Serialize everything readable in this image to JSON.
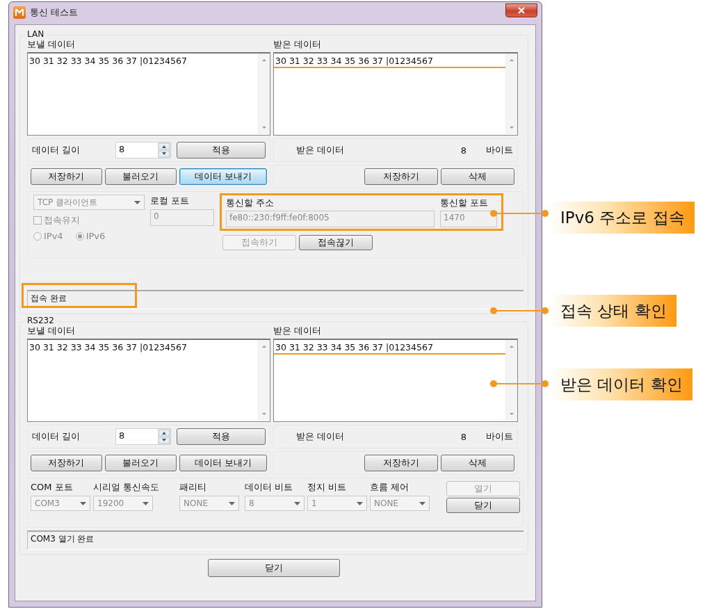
{
  "window": {
    "title": "통신 테스트"
  },
  "lan": {
    "title": "LAN",
    "send": {
      "label": "보낼 데이터",
      "value": "30 31 32 33 34 35 36 37 |01234567"
    },
    "receive": {
      "label": "받은 데이터",
      "value": "30 31 32 33 34 35 36 37 |01234567"
    },
    "length": {
      "label": "데이터 길이",
      "value": "8",
      "apply": "적용"
    },
    "received_count": {
      "label": "받은 데이터",
      "value": "8",
      "unit": "바이트"
    },
    "send_buttons": [
      {
        "label": "저장하기",
        "focused": false
      },
      {
        "label": "불러오기",
        "focused": false
      },
      {
        "label": "데이터 보내기",
        "focused": true
      }
    ],
    "receive_buttons": [
      "저장하기",
      "삭제"
    ],
    "connection": {
      "mode": "TCP 클라이언트",
      "keep_alive": {
        "label": "접속유지",
        "checked": false
      },
      "ip_versions": [
        {
          "label": "IPv4",
          "selected": false
        },
        {
          "label": "IPv6",
          "selected": true
        }
      ],
      "local_port": {
        "label": "로컬 포트",
        "value": "0",
        "disabled": true
      },
      "address": {
        "label": "통신할 주소",
        "value": "fe80::230:f9ff:fe0f:8005",
        "disabled": true
      },
      "port": {
        "label": "통신할 포트",
        "value": "1470",
        "disabled": true
      },
      "buttons": [
        {
          "label": "접속하기",
          "disabled": true
        },
        {
          "label": "접속끊기",
          "disabled": false
        }
      ]
    },
    "status": "접속 완료"
  },
  "rs232": {
    "title": "RS232",
    "send": {
      "label": "보낼 데이터",
      "value": "30 31 32 33 34 35 36 37 |01234567"
    },
    "receive": {
      "label": "받은 데이터",
      "value": "30 31 32 33 34 35 36 37 |01234567"
    },
    "length": {
      "label": "데이터 길이",
      "value": "8",
      "apply": "적용"
    },
    "received_count": {
      "label": "받은 데이터",
      "value": "8",
      "unit": "바이트"
    },
    "send_buttons": [
      {
        "label": "저장하기",
        "focused": false
      },
      {
        "label": "불러오기",
        "focused": false
      },
      {
        "label": "데이터 보내기",
        "focused": false
      }
    ],
    "receive_buttons": [
      "저장하기",
      "삭제"
    ],
    "settings": [
      {
        "label": "COM 포트",
        "value": "COM3"
      },
      {
        "label": "시리얼 통신속도",
        "value": "19200"
      },
      {
        "label": "패리티",
        "value": "NONE"
      },
      {
        "label": "데이터 비트",
        "value": "8"
      },
      {
        "label": "정지 비트",
        "value": "1"
      },
      {
        "label": "흐름 제어",
        "value": "NONE"
      }
    ],
    "port_buttons": [
      {
        "label": "열기",
        "disabled": true
      },
      {
        "label": "닫기",
        "disabled": false
      }
    ],
    "status": "COM3 열기 완료"
  },
  "close_button": "닫기",
  "callouts": [
    {
      "text": "IPv6 주소로 접속"
    },
    {
      "text": "접속 상태 확인"
    },
    {
      "text": "받은 데이터 확인"
    }
  ]
}
